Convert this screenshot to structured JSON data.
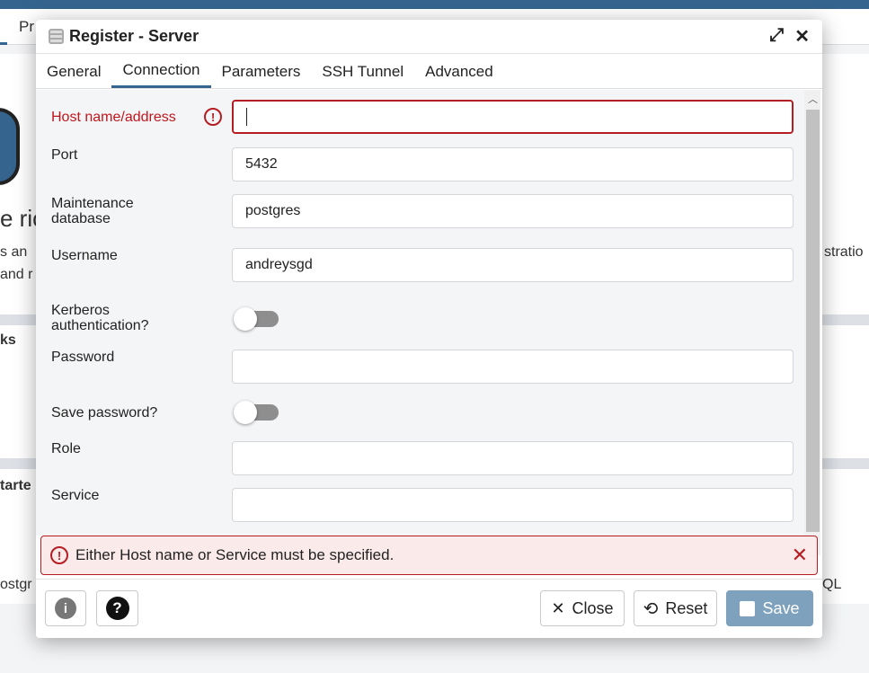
{
  "background": {
    "tab_fragment": "Pr",
    "heading_fragment": "e ric",
    "text_fragment_1": "s an",
    "text_fragment_2": "and r",
    "right_fragment": "stratio",
    "section_1": "ks",
    "section_2": "tarte",
    "link_fragment": "ostgr",
    "right_fragment_2": "QL"
  },
  "dialog": {
    "title": "Register - Server",
    "icon": "server-icon",
    "tabs": [
      {
        "label": "General"
      },
      {
        "label": "Connection",
        "active": true
      },
      {
        "label": "Parameters"
      },
      {
        "label": "SSH Tunnel"
      },
      {
        "label": "Advanced"
      }
    ],
    "fields": {
      "host": {
        "label": "Host name/address",
        "value": ""
      },
      "port": {
        "label": "Port",
        "value": "5432"
      },
      "maintenance_db": {
        "label": "Maintenance database",
        "value": "postgres"
      },
      "username": {
        "label": "Username",
        "value": "andreysgd"
      },
      "kerberos": {
        "label": "Kerberos authentication?",
        "on": false
      },
      "password": {
        "label": "Password",
        "value": ""
      },
      "save_password": {
        "label": "Save password?",
        "on": false
      },
      "role": {
        "label": "Role",
        "value": ""
      },
      "service": {
        "label": "Service",
        "value": ""
      }
    },
    "error": "Either Host name or Service must be specified.",
    "buttons": {
      "close": "Close",
      "reset": "Reset",
      "save": "Save"
    }
  },
  "colors": {
    "accent": "#35648e",
    "error": "#b41e23",
    "save": "#7ea1bd"
  }
}
